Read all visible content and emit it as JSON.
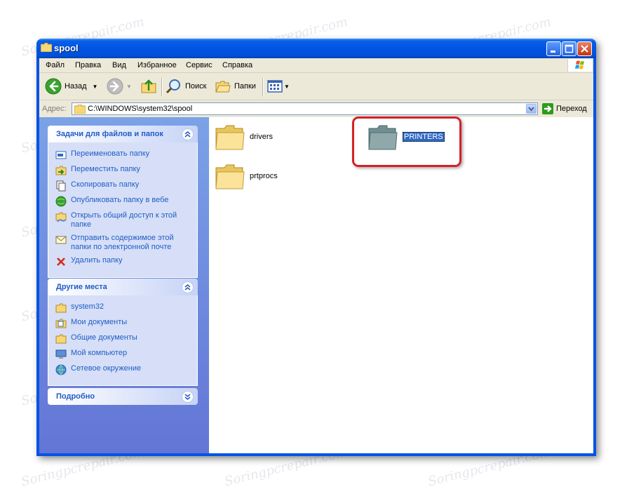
{
  "window": {
    "title": "spool"
  },
  "menu": [
    "Файл",
    "Правка",
    "Вид",
    "Избранное",
    "Сервис",
    "Справка"
  ],
  "toolbar": {
    "back": "Назад",
    "search": "Поиск",
    "folders": "Папки"
  },
  "address": {
    "label": "Адрес:",
    "path": "C:\\WINDOWS\\system32\\spool",
    "go": "Переход"
  },
  "tasks_panel": {
    "title": "Задачи для файлов и папок",
    "items": [
      {
        "label": "Переименовать папку",
        "icon": "rename-icon"
      },
      {
        "label": "Переместить папку",
        "icon": "move-icon"
      },
      {
        "label": "Скопировать папку",
        "icon": "copy-icon"
      },
      {
        "label": "Опубликовать папку в вебе",
        "icon": "publish-web-icon"
      },
      {
        "label": "Открыть общий доступ к этой папке",
        "icon": "share-icon"
      },
      {
        "label": "Отправить содержимое этой папки по электронной почте",
        "icon": "email-icon"
      },
      {
        "label": "Удалить папку",
        "icon": "delete-icon"
      }
    ]
  },
  "places_panel": {
    "title": "Другие места",
    "items": [
      {
        "label": "system32",
        "icon": "folder-icon"
      },
      {
        "label": "Мои документы",
        "icon": "my-documents-icon"
      },
      {
        "label": "Общие документы",
        "icon": "folder-icon"
      },
      {
        "label": "Мой компьютер",
        "icon": "my-computer-icon"
      },
      {
        "label": "Сетевое окружение",
        "icon": "network-icon"
      }
    ]
  },
  "details_panel": {
    "title": "Подробно"
  },
  "files": [
    {
      "name": "drivers",
      "selected": false
    },
    {
      "name": "prtprocs",
      "selected": false
    },
    {
      "name": "PRINTERS",
      "selected": true
    }
  ],
  "watermark": "Soringpcrepair.com",
  "colors": {
    "title_blue": "#0054e3",
    "task_link": "#215dc6",
    "selection": "#316ac5",
    "highlight_red": "#d42027"
  }
}
